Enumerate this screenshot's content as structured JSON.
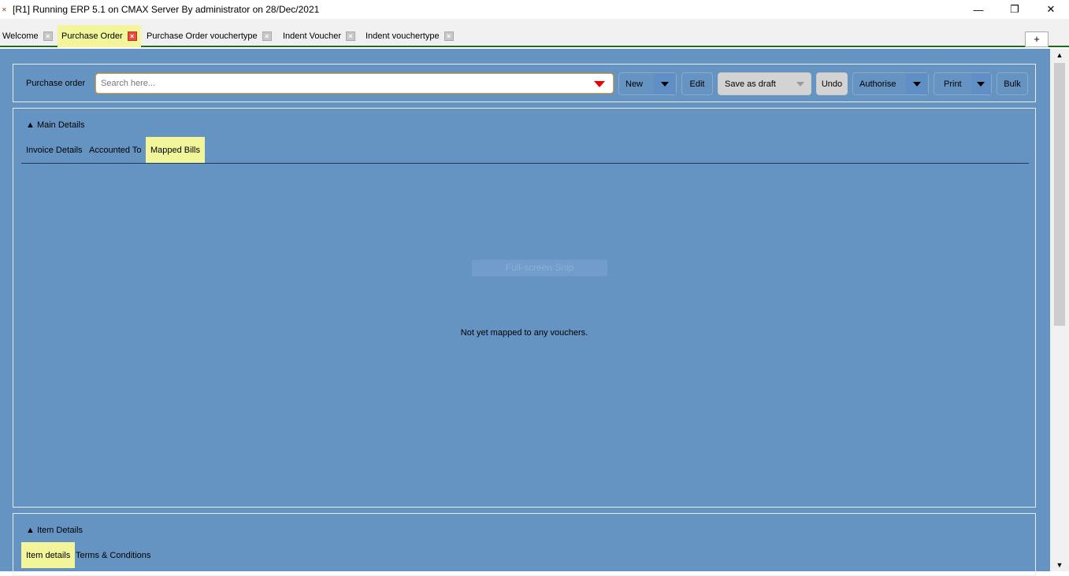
{
  "window": {
    "title": "[R1] Running ERP 5.1 on CMAX Server By administrator on 28/Dec/2021",
    "minimize": "—",
    "restore": "❐",
    "close": "✕"
  },
  "tabs": [
    {
      "label": "Welcome"
    },
    {
      "label": "Purchase Order"
    },
    {
      "label": "Purchase Order vouchertype"
    },
    {
      "label": "Indent Voucher"
    },
    {
      "label": "Indent vouchertype"
    }
  ],
  "add_tab": "+",
  "toolbar": {
    "label": "Purchase order",
    "search_placeholder": "Search here...",
    "new": "New",
    "edit": "Edit",
    "save_draft": "Save as draft",
    "undo": "Undo",
    "authorise": "Authorise",
    "print": "Print",
    "bulk": "Bulk"
  },
  "main_details": {
    "header": "▲ Main Details",
    "tabs": [
      "Invoice Details",
      "Accounted To",
      "Mapped Bills"
    ],
    "overlay": "Full-screen Snip",
    "empty_message": "Not yet mapped to any vouchers."
  },
  "item_details": {
    "header": "▲ Item Details",
    "tabs": [
      "Item details",
      "Terms & Conditions"
    ]
  }
}
